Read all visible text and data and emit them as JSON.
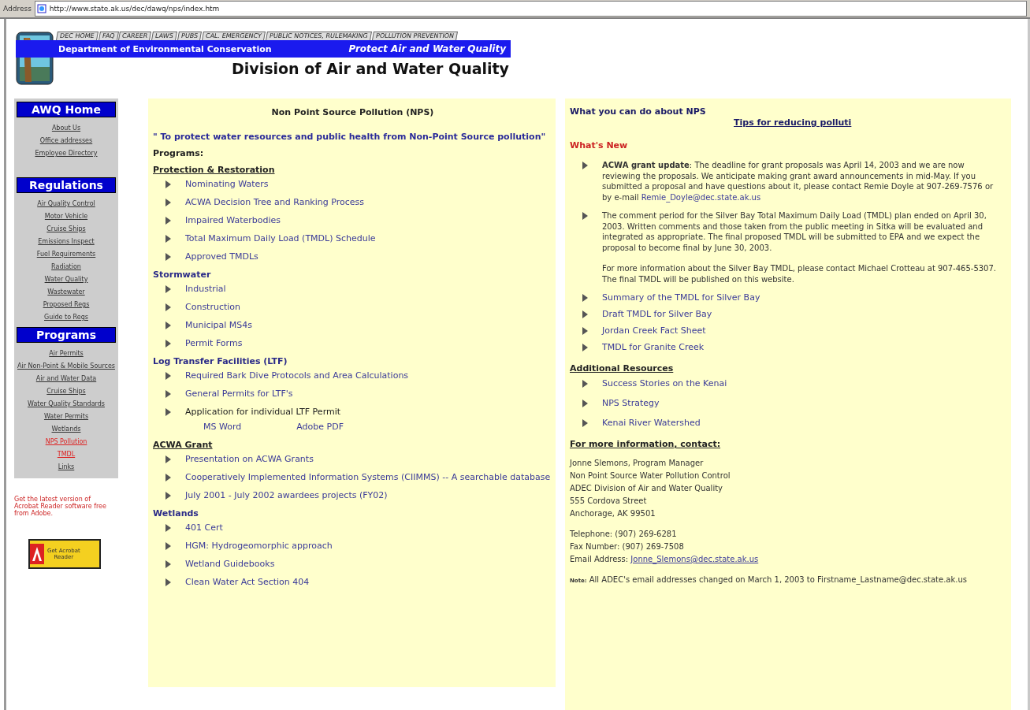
{
  "browser": {
    "address_label": "Address",
    "url": "http://www.state.ak.us/dec/dawq/nps/index.htm"
  },
  "header": {
    "tabs": [
      "DEC HOME",
      "FAQ",
      "CAREER",
      "LAWS",
      "PUBS",
      "CAL. EMERGENCY",
      "PUBLIC NOTICES, RULEMAKING",
      "POLLUTION PREVENTION"
    ],
    "department": "Department of Environmental Conservation",
    "slogan": "Protect Air and Water Quality",
    "division": "Division of Air and Water Quality"
  },
  "sidebar": {
    "sections": [
      {
        "title": "AWQ Home",
        "links": [
          {
            "label": "About Us",
            "selected": false
          },
          {
            "label": "Office addresses",
            "selected": false
          },
          {
            "label": "Employee Directory",
            "selected": false
          }
        ]
      },
      {
        "title": "Regulations",
        "links": [
          {
            "label": "Air Quality Control",
            "selected": false
          },
          {
            "label": "Motor Vehicle",
            "selected": false
          },
          {
            "label": "Cruise Ships",
            "selected": false
          },
          {
            "label": "Emissions Inspect",
            "selected": false
          },
          {
            "label": "Fuel Requirements",
            "selected": false
          },
          {
            "label": "Radiation",
            "selected": false
          },
          {
            "label": "Water Quality",
            "selected": false
          },
          {
            "label": "Wastewater",
            "selected": false
          },
          {
            "label": "Proposed Regs",
            "selected": false
          },
          {
            "label": "Guide to Regs",
            "selected": false
          }
        ]
      },
      {
        "title": "Programs",
        "links": [
          {
            "label": "Air Permits",
            "selected": false
          },
          {
            "label": "Air Non-Point & Mobile Sources",
            "selected": false
          },
          {
            "label": "Air and Water Data",
            "selected": false
          },
          {
            "label": "Cruise Ships",
            "selected": false
          },
          {
            "label": "Water Quality Standards",
            "selected": false
          },
          {
            "label": "Water Permits",
            "selected": false
          },
          {
            "label": "Wetlands",
            "selected": false
          },
          {
            "label": "NPS Pollution",
            "selected": true
          },
          {
            "label": "TMDL",
            "selected": true
          },
          {
            "label": "Links",
            "selected": false
          }
        ]
      }
    ],
    "note": "Get the latest version of Acrobat Reader software free from Adobe.",
    "badge": {
      "line1": "Get Acrobat",
      "line2": "Reader"
    }
  },
  "main": {
    "title": "Non Point Source Pollution (NPS)",
    "mission": "\" To protect water resources and public health from Non-Point Source pollution\"",
    "programs_label": "Programs:",
    "groups": [
      {
        "title": "Protection & Restoration",
        "underlined": true,
        "items": [
          {
            "label": "Nominating Waters",
            "kind": "link"
          },
          {
            "label": "ACWA Decision Tree and Ranking Process",
            "kind": "link"
          },
          {
            "label": "Impaired Waterbodies",
            "kind": "link"
          },
          {
            "label": "Total Maximum Daily Load (TMDL) Schedule",
            "kind": "link"
          },
          {
            "label": "Approved TMDLs",
            "kind": "link"
          }
        ]
      },
      {
        "title": "Stormwater",
        "underlined": false,
        "items": [
          {
            "label": "Industrial",
            "kind": "link"
          },
          {
            "label": "Construction",
            "kind": "link"
          },
          {
            "label": "Municipal MS4s",
            "kind": "link"
          },
          {
            "label": "Permit Forms",
            "kind": "link"
          }
        ]
      },
      {
        "title": "Log Transfer Facilities (LTF)",
        "underlined": false,
        "items": [
          {
            "label": "Required Bark Dive Protocols and Area Calculations",
            "kind": "link"
          },
          {
            "label": "General Permits for LTF's",
            "kind": "link"
          },
          {
            "label": "Application for individual LTF Permit",
            "kind": "text",
            "sub_links": [
              "MS Word",
              "Adobe PDF"
            ]
          }
        ]
      },
      {
        "title": "ACWA Grant",
        "underlined": true,
        "items": [
          {
            "label": "Presentation on ACWA Grants",
            "kind": "link"
          },
          {
            "label": "Cooperatively Implemented Information Systems (CIIMMS) -- A searchable database",
            "kind": "link"
          },
          {
            "label": "July 2001 - July 2002 awardees projects (FY02)",
            "kind": "link"
          }
        ]
      },
      {
        "title": "Wetlands",
        "underlined": false,
        "items": [
          {
            "label": "401 Cert",
            "kind": "link"
          },
          {
            "label": "HGM: Hydrogeomorphic approach",
            "kind": "link"
          },
          {
            "label": "Wetland Guidebooks",
            "kind": "link"
          },
          {
            "label": "Clean Water Act Section 404",
            "kind": "link"
          }
        ]
      }
    ]
  },
  "right": {
    "heading": "What you can do about NPS",
    "tips_link": "Tips for reducing polluti",
    "whats_new": "What's New",
    "news": [
      {
        "paragraphs": [
          "**ACWA grant update**: The deadline for grant proposals was April 14, 2003 and we are now reviewing the proposals. We anticipate making grant award announcements in mid-May. If you submitted a proposal and have questions about it, please contact Remie Doyle at 907-269-7576 or by e-mail"
        ],
        "link": "Remie_Doyle@dec.state.ak.us"
      },
      {
        "paragraphs": [
          "The comment period for the Silver Bay Total Maximum Daily Load (TMDL) plan ended on April 30, 2003. Written comments and those taken from the public meeting in Sitka will be evaluated and integrated as appropriate. The final proposed TMDL will be submitted to EPA and we expect the proposal to become final by June 30, 2003.",
          "For more information about the Silver Bay TMDL, please contact Michael Crotteau at 907-465-5307. The final TMDL will be published on this website."
        ]
      }
    ],
    "news_links": [
      "Summary of the TMDL for Silver Bay",
      "Draft TMDL for Silver Bay",
      "Jordan Creek Fact Sheet",
      "TMDL for Granite Creek"
    ],
    "resources": {
      "title": "Additional Resources",
      "items": [
        "Success Stories on the Kenai",
        "NPS Strategy",
        "Kenai River Watershed"
      ]
    },
    "contact": {
      "title": "For more information, contact:",
      "address": [
        "Jonne Slemons, Program Manager",
        "Non Point Source Water Pollution Control",
        "ADEC Division of Air and Water Quality",
        "555 Cordova Street",
        "Anchorage, AK 99501"
      ],
      "phone": "Telephone: (907) 269-6281",
      "fax": "Fax Number: (907) 269-7508",
      "email_label": "Email Address:",
      "email": "Jonne_Slemons@dec.state.ak.us"
    },
    "note": {
      "label": "Note:",
      "text": "All ADEC's email addresses changed on March 1, 2003 to Firstname_Lastname@dec.state.ak.us"
    }
  }
}
